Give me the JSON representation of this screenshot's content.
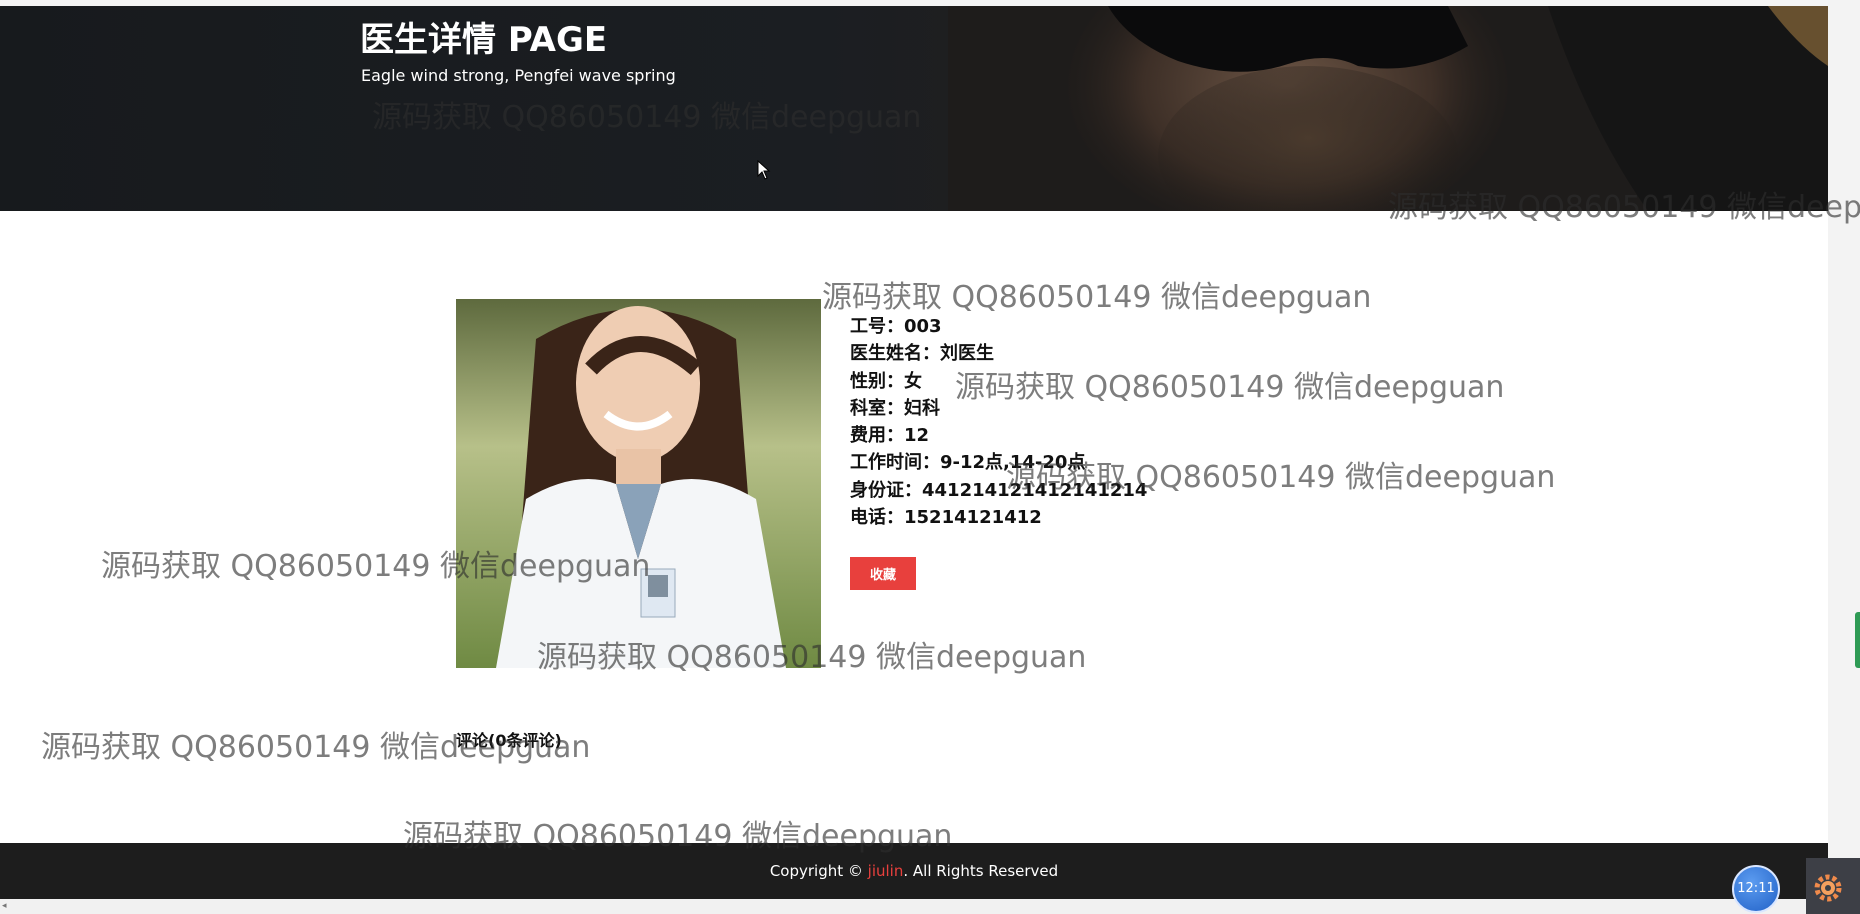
{
  "hero": {
    "title": "医生详情 PAGE",
    "subtitle": "Eagle wind strong, Pengfei wave spring"
  },
  "doctor": {
    "rows": [
      {
        "label": "工号：",
        "value": "003"
      },
      {
        "label": "医生姓名：",
        "value": "刘医生"
      },
      {
        "label": "性别：",
        "value": "女"
      },
      {
        "label": "科室：",
        "value": "妇科"
      },
      {
        "label": "费用：",
        "value": "12"
      },
      {
        "label": "工作时间：",
        "value": "9-12点,14-20点"
      },
      {
        "label": "身份证：",
        "value": "441214121412141214"
      },
      {
        "label": "电话：",
        "value": "15214121412"
      }
    ]
  },
  "actions": {
    "favorite_label": "收藏"
  },
  "comments": {
    "heading": "评论(0条评论)"
  },
  "watermark": "源码获取 QQ86050149 微信deepguan",
  "footer": {
    "prefix": "Copyright © ",
    "brand": "jiulin",
    "suffix": ". All Rights Reserved"
  },
  "taskbar": {
    "clock": "12:11"
  },
  "colors": {
    "accent": "#e8403d",
    "footer_bg": "#1d1d1d",
    "hero_bg": "#1b1e22"
  }
}
